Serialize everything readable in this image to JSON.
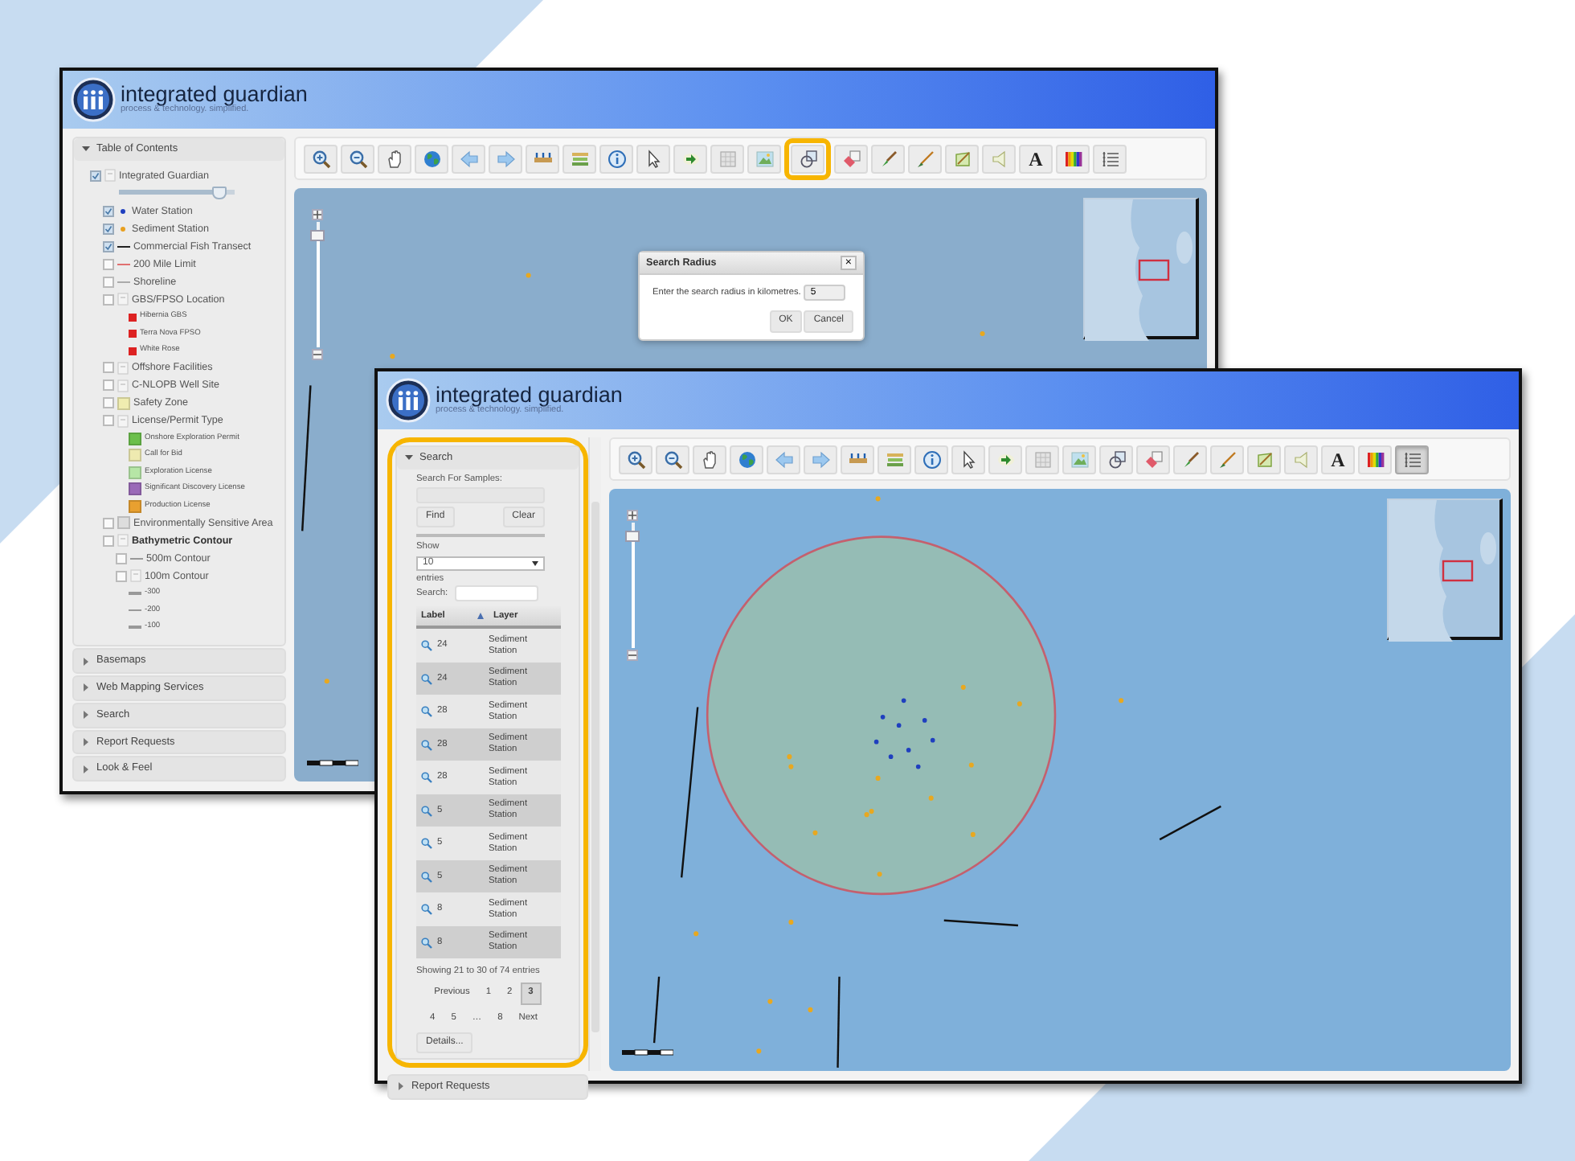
{
  "windows": [
    {
      "header": {
        "title": "integrated guardian",
        "tagline": "process & technology. simplified."
      },
      "sidebar": {
        "panels": [
          {
            "kind": "tree",
            "title": "Table of Contents",
            "expanded": true,
            "tree": [
              {
                "label": "Integrated Guardian",
                "kind": "layer",
                "checked": true,
                "symbol": {
                  "kind": "node"
                },
                "level": 0.93,
                "children": [
                  {
                    "label": "Water Station",
                    "kind": "layer",
                    "checked": true,
                    "symbol": {
                      "kind": "dot",
                      "color": "#1f3fbf"
                    }
                  },
                  {
                    "label": "Sediment Station",
                    "kind": "layer",
                    "checked": true,
                    "symbol": {
                      "kind": "dot",
                      "color": "#e8a020"
                    }
                  },
                  {
                    "label": "Commercial Fish Transect",
                    "kind": "layer",
                    "checked": true,
                    "symbol": {
                      "kind": "line",
                      "color": "#222222"
                    }
                  },
                  {
                    "label": "200 Mile Limit",
                    "kind": "layer",
                    "checked": false,
                    "symbol": {
                      "kind": "line",
                      "color": "#e07070"
                    }
                  },
                  {
                    "label": "Shoreline",
                    "kind": "layer",
                    "checked": false,
                    "symbol": {
                      "kind": "line",
                      "color": "#aaaaaa"
                    }
                  },
                  {
                    "label": "GBS/FPSO Location",
                    "kind": "layer",
                    "checked": false,
                    "symbol": {
                      "kind": "node"
                    },
                    "children": [
                      {
                        "label": "Hibernia GBS",
                        "kind": "legend",
                        "symbol": {
                          "kind": "square",
                          "color": "#dd2222"
                        }
                      },
                      {
                        "label": "Terra Nova FPSO",
                        "kind": "legend",
                        "symbol": {
                          "kind": "square",
                          "color": "#dd2222"
                        }
                      },
                      {
                        "label": "White Rose",
                        "kind": "legend",
                        "symbol": {
                          "kind": "square",
                          "color": "#dd2222"
                        }
                      }
                    ]
                  },
                  {
                    "label": "Offshore Facilities",
                    "kind": "layer",
                    "checked": false,
                    "symbol": {
                      "kind": "node"
                    }
                  },
                  {
                    "label": "C-NLOPB Well Site",
                    "kind": "layer",
                    "checked": false,
                    "symbol": {
                      "kind": "node"
                    }
                  },
                  {
                    "label": "Safety Zone",
                    "kind": "layer",
                    "checked": false,
                    "symbol": {
                      "kind": "swatch",
                      "color": "#f0edb0"
                    }
                  },
                  {
                    "label": "License/Permit Type",
                    "kind": "layer",
                    "checked": false,
                    "symbol": {
                      "kind": "node"
                    },
                    "children": [
                      {
                        "label": "Onshore Exploration Permit",
                        "kind": "legend",
                        "symbol": {
                          "kind": "swatch",
                          "color": "#6cbf4c"
                        }
                      },
                      {
                        "label": "Call for Bid",
                        "kind": "legend",
                        "symbol": {
                          "kind": "swatch",
                          "color": "#eeeab0"
                        }
                      },
                      {
                        "label": "Exploration License",
                        "kind": "legend",
                        "symbol": {
                          "kind": "swatch",
                          "color": "#b6e6a6"
                        }
                      },
                      {
                        "label": "Significant Discovery License",
                        "kind": "legend",
                        "symbol": {
                          "kind": "swatch",
                          "color": "#9a6ab8"
                        }
                      },
                      {
                        "label": "Production License",
                        "kind": "legend",
                        "symbol": {
                          "kind": "swatch",
                          "color": "#e8a030"
                        }
                      }
                    ]
                  },
                  {
                    "label": "Environmentally Sensitive Area",
                    "kind": "layer",
                    "checked": false,
                    "symbol": {
                      "kind": "swatch",
                      "color": "#dddddd"
                    }
                  },
                  {
                    "label": "Bathymetric Contour",
                    "kind": "group",
                    "checked": false,
                    "symbol": {
                      "kind": "node"
                    },
                    "children": [
                      {
                        "label": "500m Contour",
                        "kind": "layer",
                        "checked": false,
                        "symbol": {
                          "kind": "line",
                          "color": "#999999"
                        }
                      },
                      {
                        "label": "100m Contour",
                        "kind": "layer",
                        "checked": false,
                        "symbol": {
                          "kind": "node"
                        }
                      },
                      {
                        "label": "-300",
                        "kind": "legend",
                        "symbol": {
                          "kind": "line",
                          "color": "#999999"
                        }
                      },
                      {
                        "label": "-200",
                        "kind": "legend",
                        "symbol": {
                          "kind": "line",
                          "color": "#999999"
                        }
                      },
                      {
                        "label": "-100",
                        "kind": "legend",
                        "symbol": {
                          "kind": "line",
                          "color": "#999999"
                        }
                      }
                    ]
                  }
                ]
              }
            ]
          },
          {
            "kind": "plain",
            "title": "Basemaps",
            "expanded": false
          },
          {
            "kind": "plain",
            "title": "Web Mapping Services",
            "expanded": false
          },
          {
            "kind": "plain",
            "title": "Search",
            "expanded": false
          },
          {
            "kind": "plain",
            "title": "Report Requests",
            "expanded": false
          },
          {
            "kind": "plain",
            "title": "Look & Feel",
            "expanded": false
          }
        ]
      },
      "toolbar": [
        {
          "kind": "zoom-in",
          "selected": false,
          "highlighted": false
        },
        {
          "kind": "zoom-out",
          "selected": false,
          "highlighted": false
        },
        {
          "kind": "hand",
          "selected": false,
          "highlighted": false
        },
        {
          "kind": "globe",
          "selected": false,
          "highlighted": false
        },
        {
          "kind": "arrow-left",
          "selected": false,
          "highlighted": false
        },
        {
          "kind": "arrow-right",
          "selected": false,
          "highlighted": false
        },
        {
          "kind": "ruler",
          "selected": false,
          "highlighted": false
        },
        {
          "kind": "stack",
          "selected": false,
          "highlighted": false
        },
        {
          "kind": "info",
          "selected": false,
          "highlighted": false
        },
        {
          "kind": "pointer",
          "selected": false,
          "highlighted": false
        },
        {
          "kind": "go",
          "selected": false,
          "highlighted": false
        },
        {
          "kind": "table",
          "selected": false,
          "highlighted": false
        },
        {
          "kind": "image",
          "selected": false,
          "highlighted": false
        },
        {
          "kind": "radius",
          "selected": false,
          "highlighted": true
        },
        {
          "kind": "eraser",
          "selected": false,
          "highlighted": false
        },
        {
          "kind": "brush",
          "selected": false,
          "highlighted": false
        },
        {
          "kind": "pen",
          "selected": false,
          "highlighted": false
        },
        {
          "kind": "polygon",
          "selected": false,
          "highlighted": false
        },
        {
          "kind": "speaker",
          "selected": false,
          "highlighted": false
        },
        {
          "kind": "letter",
          "glyph": "A",
          "selected": false,
          "highlighted": false
        },
        {
          "kind": "spectrum",
          "selected": false,
          "highlighted": false
        },
        {
          "kind": "list",
          "selected": false,
          "highlighted": false
        }
      ],
      "map": {
        "zoom_slider": {
          "level": 0.93
        },
        "dialog": {
          "title": "Search Radius",
          "close": "×",
          "prompt": "Enter the search radius in kilometres.",
          "value": "5",
          "buttons": [
            "OK",
            "Cancel"
          ]
        }
      }
    },
    {
      "header": {
        "title": "integrated guardian",
        "tagline": "process & technology. simplified."
      },
      "sidebar": {
        "panels": [
          {
            "kind": "search",
            "title": "Search",
            "expanded": true,
            "highlighted": true,
            "search_label": "Search For Samples:",
            "buttons": [
              "Find",
              "Clear"
            ],
            "show_label": "Show",
            "page_size": "10",
            "entries_label": "entries",
            "filter_label": "Search:",
            "columns": [
              {
                "label": "Label",
                "sorted": true
              },
              {
                "label": "Layer",
                "sorted": false
              }
            ],
            "rows": [
              {
                "label": "24",
                "layer": "Sediment Station"
              },
              {
                "label": "24",
                "layer": "Sediment Station"
              },
              {
                "label": "28",
                "layer": "Sediment Station"
              },
              {
                "label": "28",
                "layer": "Sediment Station"
              },
              {
                "label": "28",
                "layer": "Sediment Station"
              },
              {
                "label": "5",
                "layer": "Sediment Station"
              },
              {
                "label": "5",
                "layer": "Sediment Station"
              },
              {
                "label": "5",
                "layer": "Sediment Station"
              },
              {
                "label": "8",
                "layer": "Sediment Station"
              },
              {
                "label": "8",
                "layer": "Sediment Station"
              }
            ],
            "info": "Showing 21 to 30 of 74 entries",
            "pages": [
              {
                "label": "Previous",
                "kind": "link",
                "selected": false
              },
              {
                "label": "1",
                "kind": "link",
                "selected": false
              },
              {
                "label": "2",
                "kind": "link",
                "selected": false
              },
              {
                "label": "3",
                "kind": "link",
                "selected": true
              },
              {
                "label": "4",
                "kind": "link",
                "selected": false
              },
              {
                "label": "5",
                "kind": "link",
                "selected": false
              },
              {
                "label": "…",
                "kind": "gap"
              },
              {
                "label": "8",
                "kind": "link",
                "selected": false
              },
              {
                "label": "Next",
                "kind": "link",
                "selected": false
              }
            ],
            "details_button": "Details..."
          },
          {
            "kind": "plain",
            "title": "Report Requests",
            "expanded": false
          }
        ]
      },
      "toolbar": [
        {
          "kind": "zoom-in",
          "selected": false,
          "highlighted": false
        },
        {
          "kind": "zoom-out",
          "selected": false,
          "highlighted": false
        },
        {
          "kind": "hand",
          "selected": false,
          "highlighted": false
        },
        {
          "kind": "globe",
          "selected": false,
          "highlighted": false
        },
        {
          "kind": "arrow-left",
          "selected": false,
          "highlighted": false
        },
        {
          "kind": "arrow-right",
          "selected": false,
          "highlighted": false
        },
        {
          "kind": "ruler",
          "selected": false,
          "highlighted": false
        },
        {
          "kind": "stack",
          "selected": false,
          "highlighted": false
        },
        {
          "kind": "info",
          "selected": false,
          "highlighted": false
        },
        {
          "kind": "pointer",
          "selected": false,
          "highlighted": false
        },
        {
          "kind": "go",
          "selected": false,
          "highlighted": false
        },
        {
          "kind": "table",
          "selected": false,
          "highlighted": false
        },
        {
          "kind": "image",
          "selected": false,
          "highlighted": false
        },
        {
          "kind": "radius",
          "selected": false,
          "highlighted": false
        },
        {
          "kind": "eraser",
          "selected": false,
          "highlighted": false
        },
        {
          "kind": "brush",
          "selected": false,
          "highlighted": false
        },
        {
          "kind": "pen",
          "selected": false,
          "highlighted": false
        },
        {
          "kind": "polygon",
          "selected": false,
          "highlighted": false
        },
        {
          "kind": "speaker",
          "selected": false,
          "highlighted": false
        },
        {
          "kind": "letter",
          "glyph": "A",
          "selected": false,
          "highlighted": false
        },
        {
          "kind": "spectrum",
          "selected": false,
          "highlighted": false
        },
        {
          "kind": "list",
          "selected": true,
          "highlighted": false
        }
      ],
      "map": {
        "zoom_slider": {
          "level": 0.93
        },
        "search_area": true
      }
    }
  ]
}
